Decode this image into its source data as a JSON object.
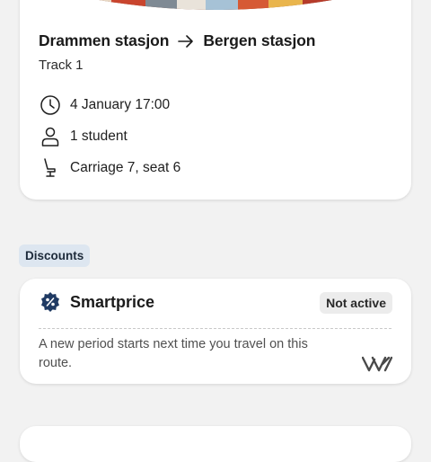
{
  "trip": {
    "from": "Drammen stasjon",
    "to": "Bergen stasjon",
    "track": "Track 1",
    "details": [
      {
        "icon": "clock-icon",
        "text": "4 January 17:00"
      },
      {
        "icon": "person-icon",
        "text": "1 student"
      },
      {
        "icon": "seat-icon",
        "text": "Carriage 7, seat 6"
      }
    ]
  },
  "discounts": {
    "tag_label": "Discounts",
    "card": {
      "title": "Smartprice",
      "status": "Not active",
      "description": "A new period starts next time you travel on this route.",
      "icon": "percent-badge-icon",
      "logo": "vy-logo"
    }
  },
  "colors": {
    "background": "#f2f2f2",
    "card": "#ffffff",
    "discount_tag": "#dde6f0",
    "badge_icon": "#1f3a63",
    "status_badge": "#ececec"
  }
}
